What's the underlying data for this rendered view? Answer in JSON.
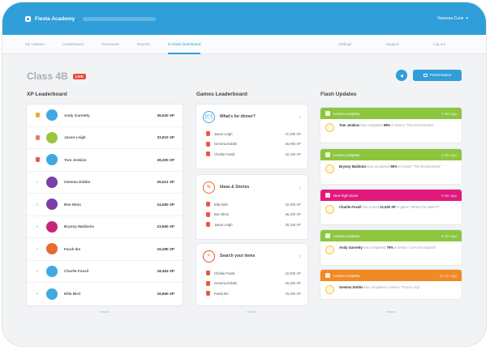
{
  "app": {
    "name": "Fiesta Academy",
    "user_label": "Vanessa Curie",
    "user_chevron": "▾"
  },
  "nav": {
    "items": [
      "My Classes",
      "Leaderboard",
      "Homework",
      "Reports",
      "In-Class Dashboard"
    ],
    "active_index": 4,
    "right": [
      "Settings",
      "Support",
      "Log out"
    ]
  },
  "header": {
    "class_name": "Class 4B",
    "live_badge": "LIVE",
    "circle_glyph": "◀",
    "button_label": "Presentation"
  },
  "xp": {
    "title": "XP Leaderboard",
    "rows": [
      {
        "rank": "1",
        "trophy": "gold",
        "name": "Andy Garnetty",
        "xp": "39,520 XP",
        "color": "#3ea9e2"
      },
      {
        "rank": "2",
        "trophy": "silver",
        "name": "Jason Leigh",
        "xp": "33,910 XP",
        "color": "#9bc53d"
      },
      {
        "rank": "3",
        "trophy": "bronze",
        "name": "Tom Jenkins",
        "xp": "28,200 XP",
        "color": "#3ea9e2"
      },
      {
        "rank": "4",
        "trophy": "",
        "name": "Gemma Dobbs",
        "xp": "26,021 XP",
        "color": "#7b3fa6"
      },
      {
        "rank": "5",
        "trophy": "",
        "name": "Ben Elms",
        "xp": "24,060 XP",
        "color": "#7b3fa6"
      },
      {
        "rank": "6",
        "trophy": "",
        "name": "Bryony Maldonis",
        "xp": "23,560 XP",
        "color": "#c9247a"
      },
      {
        "rank": "7",
        "trophy": "",
        "name": "Farah Ike",
        "xp": "19,280 XP",
        "color": "#e86a2e"
      },
      {
        "rank": "8",
        "trophy": "",
        "name": "Charlie Fossil",
        "xp": "18,463 XP",
        "color": "#3ea9e2"
      },
      {
        "rank": "9",
        "trophy": "",
        "name": "Ellie Bird",
        "xp": "16,660 XP",
        "color": "#3ea9e2"
      }
    ]
  },
  "games": {
    "title": "Games Leaderboard",
    "cards": [
      {
        "name": "What's for dinner?",
        "count": "3",
        "icon": "🍽",
        "accent": "#3ea9e2",
        "rows": [
          {
            "name": "Jason Leigh",
            "score": "47,200 XP"
          },
          {
            "name": "Gemma Dobbs",
            "score": "36,900 XP"
          },
          {
            "name": "Charlie Fossil",
            "score": "32,100 XP"
          }
        ]
      },
      {
        "name": "Ideas & Stories",
        "count": "3",
        "icon": "✎",
        "accent": "#e86a2e",
        "rows": [
          {
            "name": "Ellie Bird",
            "score": "42,000 XP"
          },
          {
            "name": "Ben Elms",
            "score": "36,200 XP"
          },
          {
            "name": "Jason Leigh",
            "score": "30,100 XP"
          }
        ]
      },
      {
        "name": "Search your items",
        "count": "3",
        "icon": "⌕",
        "accent": "#e74c3c",
        "rows": [
          {
            "name": "Charlie Fossil",
            "score": "42,600 XP"
          },
          {
            "name": "Gemma Dobbs",
            "score": "40,200 XP"
          },
          {
            "name": "Farah Ike",
            "score": "33,200 XP"
          }
        ]
      }
    ]
  },
  "flash": {
    "title": "Flash Updates",
    "items": [
      {
        "label": "Lesson complete",
        "time": "2 min ago",
        "color": "#8cc63f",
        "name": "Tom Jenkins",
        "pre": "has completed",
        "value": "98%",
        "post": "in lesson \"The Environment\""
      },
      {
        "label": "Lesson complete",
        "time": "5 min ago",
        "color": "#8cc63f",
        "name": "Bryony Maldonis",
        "pre": "has completed",
        "value": "96%",
        "post": "in lesson \"The Environment\""
      },
      {
        "label": "New high Score",
        "time": "8 min ago",
        "color": "#e0197d",
        "name": "Charlie Fossil",
        "pre": "has scored",
        "value": "31,500 XP",
        "post": "in game \"What's for dinner?\""
      },
      {
        "label": "Lesson complete",
        "time": "9 min ago",
        "color": "#8cc63f",
        "name": "Andy Garnetty",
        "pre": "has completed",
        "value": "79%",
        "post": "in lesson \"Let's Get Started\""
      },
      {
        "label": "Lesson complete",
        "time": "12 min ago",
        "color": "#f08a24",
        "name": "Gemma Dobbs",
        "pre": "has completed",
        "value": "",
        "post": "a lesson \"Fruit & Veg\""
      }
    ]
  }
}
